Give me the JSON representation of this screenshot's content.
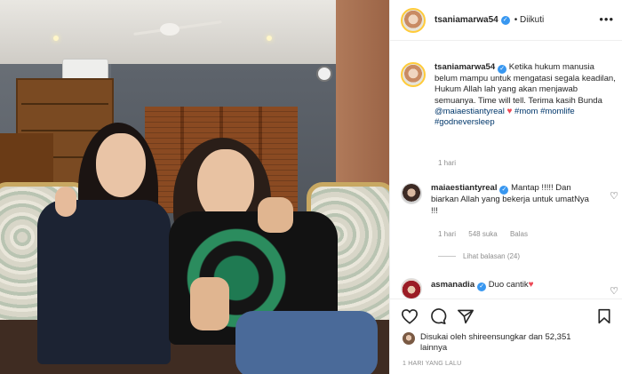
{
  "post": {
    "username": "tsaniamarwa54",
    "follow_status": "Diikuti",
    "more_icon": "more-horizontal-icon"
  },
  "caption": {
    "username": "tsaniamarwa54",
    "text_1": "Ketika hukum manusia belum mampu untuk mengatasi segala keadilan, Hukum Allah lah yang akan menjawab semuanya. Time will tell. Terima kasih Bunda ",
    "mention": "@maiaestiantyreal",
    "tags": "#mom #momlife #godneversleep",
    "time": "1 hari"
  },
  "comments": [
    {
      "username": "maiaestiantyreal",
      "text": "Mantap !!!!! Dan biarkan Allah yang bekerja untuk umatNya !!!",
      "time": "1 hari",
      "likes": "548 suka",
      "reply": "Balas",
      "view_replies": "Lihat balasan (24)"
    },
    {
      "username": "asmanadia",
      "text": "Duo cantik"
    }
  ],
  "footer": {
    "liked_by": "Disukai oleh shireensungkar dan 52,351 lainnya",
    "timestamp": "1 HARI YANG LALU"
  },
  "colors": {
    "verified": "#3897f0",
    "link": "#00376b",
    "heart": "#ed4956",
    "muted": "#8e8e8e"
  }
}
